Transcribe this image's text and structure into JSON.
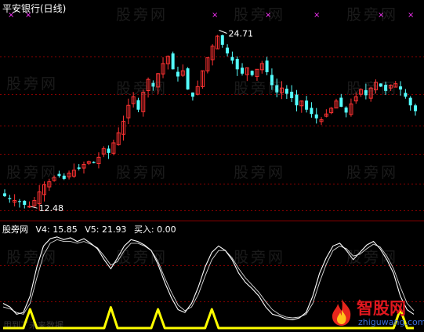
{
  "chart_title": "平安银行(日线)",
  "price_chart": {
    "type": "candlestick",
    "high_annotation": "24.71",
    "low_annotation": "12.48",
    "high_value": 24.71,
    "low_value": 12.48,
    "close_path": [
      13.2,
      13.0,
      12.9,
      12.8,
      12.6,
      12.5,
      12.9,
      13.5,
      14.0,
      14.2,
      14.5,
      14.6,
      14.4,
      14.8,
      15.0,
      15.1,
      15.4,
      15.6,
      15.5,
      15.9,
      16.5,
      16.2,
      16.9,
      17.6,
      18.4,
      19.5,
      20.1,
      19.2,
      20.4,
      21.3,
      20.8,
      21.7,
      22.4,
      22.9,
      22.0,
      21.5,
      21.9,
      20.6,
      20.1,
      20.8,
      21.9,
      22.8,
      23.6,
      24.3,
      23.7,
      23.1,
      22.6,
      22.0,
      21.7,
      22.1,
      21.6,
      22.0,
      22.4,
      21.8,
      20.9,
      20.4,
      20.7,
      20.3,
      20.0,
      19.5,
      19.8,
      19.2,
      18.9,
      18.6,
      18.5,
      18.9,
      19.3,
      19.8,
      19.4,
      19.0,
      19.6,
      20.1,
      20.6,
      20.2,
      20.7,
      21.1,
      20.8,
      20.5,
      20.9,
      21.0,
      20.6,
      20.1,
      19.5,
      19.1
    ],
    "top_markers": "×"
  },
  "indicator": {
    "name": "股旁网",
    "v4_label": "V4: 15.85",
    "v5_label": "V5: 21.93",
    "buy_label": "买入: 0.00"
  },
  "chart_data": [
    {
      "type": "line",
      "title": "平安银行(日线)",
      "series": [
        {
          "values": [
            13.2,
            13.0,
            12.9,
            12.8,
            12.6,
            12.5,
            12.9,
            13.5,
            14.0,
            14.2,
            14.5,
            14.6,
            14.4,
            14.8,
            15.0,
            15.1,
            15.4,
            15.6,
            15.5,
            15.9,
            16.5,
            16.2,
            16.9,
            17.6,
            18.4,
            19.5,
            20.1,
            19.2,
            20.4,
            21.3,
            20.8,
            21.7,
            22.4,
            22.9,
            22.0,
            21.5,
            21.9,
            20.6,
            20.1,
            20.8,
            21.9,
            22.8,
            23.6,
            24.3,
            23.7,
            23.1,
            22.6,
            22.0,
            21.7,
            22.1,
            21.6,
            22.0,
            22.4,
            21.8,
            20.9,
            20.4,
            20.7,
            20.3,
            20.0,
            19.5,
            19.8,
            19.2,
            18.9,
            18.6,
            18.5,
            18.9,
            19.3,
            19.8,
            19.4,
            19.0,
            19.6,
            20.1,
            20.6,
            20.2,
            20.7,
            21.1,
            20.8,
            20.5,
            20.9,
            21.0,
            20.6,
            20.1,
            19.5,
            19.1
          ]
        }
      ],
      "annotations": [
        "24.71",
        "12.48"
      ]
    },
    {
      "type": "line",
      "series": [
        {
          "name": "V4",
          "values": [
            0.22,
            0.18,
            0.1,
            0.12,
            0.3,
            0.62,
            0.85,
            0.93,
            0.95,
            0.92,
            0.94,
            0.9,
            0.93,
            0.88,
            0.82,
            0.7,
            0.6,
            0.72,
            0.85,
            0.92,
            0.9,
            0.86,
            0.8,
            0.65,
            0.45,
            0.28,
            0.15,
            0.12,
            0.22,
            0.4,
            0.62,
            0.78,
            0.85,
            0.8,
            0.7,
            0.55,
            0.45,
            0.38,
            0.3,
            0.18,
            0.1,
            0.08,
            0.05,
            0.04,
            0.06,
            0.12,
            0.3,
            0.55,
            0.72,
            0.85,
            0.88,
            0.8,
            0.7,
            0.78,
            0.86,
            0.9,
            0.82,
            0.7,
            0.55,
            0.3,
            0.15,
            0.1
          ],
          "value": 15.85
        },
        {
          "name": "V5",
          "values": [
            0.18,
            0.16,
            0.12,
            0.1,
            0.22,
            0.5,
            0.75,
            0.88,
            0.92,
            0.9,
            0.9,
            0.88,
            0.9,
            0.87,
            0.83,
            0.74,
            0.64,
            0.68,
            0.8,
            0.88,
            0.88,
            0.85,
            0.8,
            0.68,
            0.5,
            0.34,
            0.2,
            0.14,
            0.18,
            0.32,
            0.52,
            0.7,
            0.8,
            0.8,
            0.72,
            0.6,
            0.5,
            0.42,
            0.34,
            0.24,
            0.15,
            0.1,
            0.07,
            0.06,
            0.07,
            0.1,
            0.22,
            0.45,
            0.65,
            0.8,
            0.85,
            0.82,
            0.74,
            0.76,
            0.82,
            0.87,
            0.84,
            0.74,
            0.6,
            0.4,
            0.22,
            0.14
          ],
          "value": 21.93
        },
        {
          "name": "买入",
          "values": [
            0,
            0,
            0,
            0,
            0.2,
            0,
            0,
            0,
            0,
            0,
            0,
            0,
            0,
            0,
            0,
            0,
            0.22,
            0,
            0,
            0,
            0,
            0,
            0,
            0.2,
            0,
            0,
            0,
            0,
            0,
            0,
            0,
            0.2,
            0,
            0,
            0,
            0,
            0,
            0,
            0,
            0,
            0,
            0,
            0,
            0,
            0,
            0,
            0,
            0,
            0,
            0,
            0,
            0,
            0,
            0,
            0,
            0,
            0,
            0,
            0,
            0.2,
            0,
            0
          ],
          "value": 0.0
        }
      ]
    }
  ],
  "watermark_text": "股旁网",
  "logo": {
    "name": "智股网",
    "url": "zhiguwang.com"
  },
  "bottom_text": "用到了未来数据",
  "colors": {
    "up": "#ff3232",
    "down": "#54ffff",
    "marker": "#ff33ff",
    "line": "#ffffff",
    "buy": "#ffff00",
    "grid": "#8b0000",
    "bg": "#000000"
  }
}
